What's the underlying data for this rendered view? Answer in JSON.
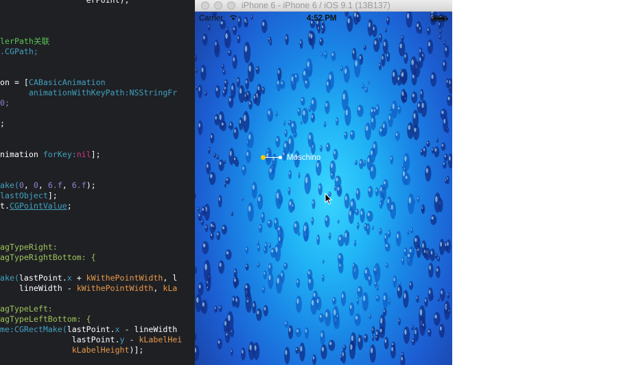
{
  "editor": {
    "lines": [
      [
        {
          "t": "                  erPoint);",
          "c": "plain"
        }
      ],
      [],
      [],
      [],
      [
        {
          "t": "lerPath关联",
          "c": "green"
        }
      ],
      [
        {
          "t": ".CGPath;",
          "c": "teal"
        }
      ],
      [],
      [],
      [
        {
          "t": "on = [",
          "c": "plain"
        },
        {
          "t": "CABasicAnimation",
          "c": "teal"
        }
      ],
      [
        {
          "t": "      animationWithKeyPath:",
          "c": "teal"
        },
        {
          "t": "NSStringFr",
          "c": "teal"
        }
      ],
      [
        {
          "t": "0;",
          "c": "purple"
        }
      ],
      [],
      [
        {
          "t": ";",
          "c": "plain"
        }
      ],
      [],
      [],
      [
        {
          "t": "nimation ",
          "c": "plain"
        },
        {
          "t": "forKey:",
          "c": "teal"
        },
        {
          "t": "nil",
          "c": "pink"
        },
        {
          "t": "];",
          "c": "plain"
        }
      ],
      [],
      [],
      [
        {
          "t": "ake(",
          "c": "teal"
        },
        {
          "t": "0",
          "c": "purple"
        },
        {
          "t": ", ",
          "c": "plain"
        },
        {
          "t": "0",
          "c": "purple"
        },
        {
          "t": ", ",
          "c": "plain"
        },
        {
          "t": "6.f",
          "c": "purple"
        },
        {
          "t": ", ",
          "c": "plain"
        },
        {
          "t": "6.f",
          "c": "purple"
        },
        {
          "t": ");",
          "c": "plain"
        }
      ],
      [
        {
          "t": "lastObject",
          "c": "teal"
        },
        {
          "t": "];",
          "c": "plain"
        }
      ],
      [
        {
          "t": "t.",
          "c": "plain"
        },
        {
          "t": "CGPointValue",
          "c": "cyan"
        },
        {
          "t": ";",
          "c": "plain"
        }
      ],
      [],
      [],
      [],
      [
        {
          "t": "agTypeRight:",
          "c": "lime"
        }
      ],
      [
        {
          "t": "agTypeRightBottom: {",
          "c": "lime"
        }
      ],
      [],
      [
        {
          "t": "ake(",
          "c": "teal"
        },
        {
          "t": "lastPoint.",
          "c": "plain"
        },
        {
          "t": "x",
          "c": "teal"
        },
        {
          "t": " + ",
          "c": "plain"
        },
        {
          "t": "kWithePointWidth",
          "c": "orange"
        },
        {
          "t": ", l",
          "c": "plain"
        }
      ],
      [
        {
          "t": "    lineWidth - ",
          "c": "plain"
        },
        {
          "t": "kWithePointWidth",
          "c": "orange"
        },
        {
          "t": ", ",
          "c": "plain"
        },
        {
          "t": "kLa",
          "c": "orange"
        }
      ],
      [],
      [
        {
          "t": "agTypeLeft:",
          "c": "lime"
        }
      ],
      [
        {
          "t": "agTypeLeftBottom: {",
          "c": "lime"
        }
      ],
      [
        {
          "t": "me:",
          "c": "teal"
        },
        {
          "t": "CGRectMake(",
          "c": "teal"
        },
        {
          "t": "lastPoint.",
          "c": "plain"
        },
        {
          "t": "x",
          "c": "teal"
        },
        {
          "t": " - lineWidth",
          "c": "plain"
        }
      ],
      [
        {
          "t": "               lastPoint.",
          "c": "plain"
        },
        {
          "t": "y",
          "c": "teal"
        },
        {
          "t": " - ",
          "c": "plain"
        },
        {
          "t": "kLabelHei",
          "c": "orange"
        }
      ],
      [
        {
          "t": "               ",
          "c": "plain"
        },
        {
          "t": "kLabelHeight",
          "c": "orange"
        },
        {
          "t": ")];",
          "c": "plain"
        }
      ]
    ]
  },
  "simulator": {
    "window_title": "iPhone 6 - iPhone 6 / iOS 9.1 (13B137)",
    "status_bar": {
      "carrier": "Carrier",
      "time": "4:52 PM",
      "wifi_icon": "wifi-icon",
      "battery_icon": "battery-icon"
    },
    "tag": {
      "label": "Moschino",
      "dot_color": "#ffcc00",
      "line_color": "#ffffff"
    },
    "cursor_icon": "mouse-pointer-icon",
    "colors": {
      "background_center": "#3ad6ff",
      "background_edge": "#1a3d9c"
    }
  }
}
